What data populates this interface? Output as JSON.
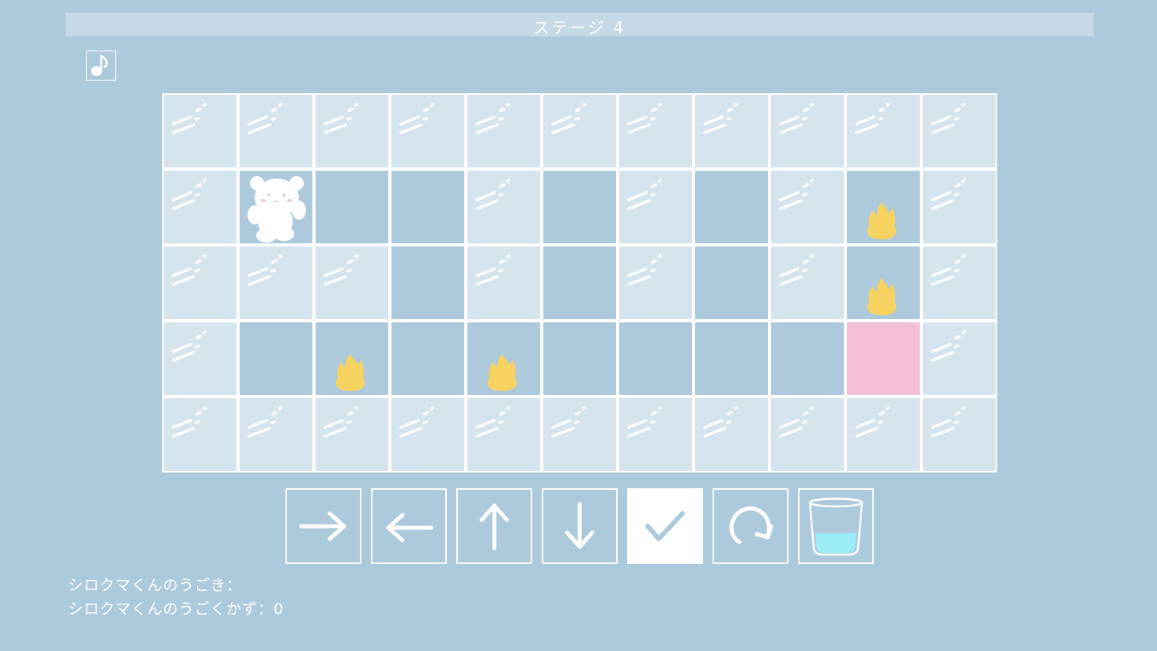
{
  "title": "ステージ 4",
  "music_button": {
    "icon": "music-note-icon"
  },
  "board": {
    "columns": 11,
    "rows": 5,
    "grid": [
      [
        "ice",
        "ice",
        "ice",
        "ice",
        "ice",
        "ice",
        "ice",
        "ice",
        "ice",
        "ice",
        "ice"
      ],
      [
        "ice",
        "bear",
        "path",
        "path",
        "ice",
        "path",
        "ice",
        "path",
        "ice",
        "fire",
        "ice"
      ],
      [
        "ice",
        "ice",
        "ice",
        "path",
        "ice",
        "path",
        "ice",
        "path",
        "ice",
        "fire",
        "ice"
      ],
      [
        "ice",
        "path",
        "fire",
        "path",
        "fire",
        "path",
        "path",
        "path",
        "path",
        "goal",
        "ice"
      ],
      [
        "ice",
        "ice",
        "ice",
        "ice",
        "ice",
        "ice",
        "ice",
        "ice",
        "ice",
        "ice",
        "ice"
      ]
    ],
    "colors": {
      "ice": "#d6e4ee",
      "path": "#adcadd",
      "goal": "#f5bfd5",
      "fire": "#f6d260"
    }
  },
  "controls": [
    {
      "name": "move-right-button",
      "icon": "arrow-right-icon",
      "active": false
    },
    {
      "name": "move-left-button",
      "icon": "arrow-left-icon",
      "active": false
    },
    {
      "name": "move-up-button",
      "icon": "arrow-up-icon",
      "active": false
    },
    {
      "name": "move-down-button",
      "icon": "arrow-down-icon",
      "active": false
    },
    {
      "name": "confirm-button",
      "icon": "check-icon",
      "active": true
    },
    {
      "name": "reset-button",
      "icon": "redo-icon",
      "active": false
    },
    {
      "name": "water-button",
      "icon": "water-glass-icon",
      "active": false
    }
  ],
  "status": {
    "moves_label": "シロクマくんのうごき：",
    "count_label": "シロクマくんのうごくかず：",
    "count_value": "0"
  }
}
